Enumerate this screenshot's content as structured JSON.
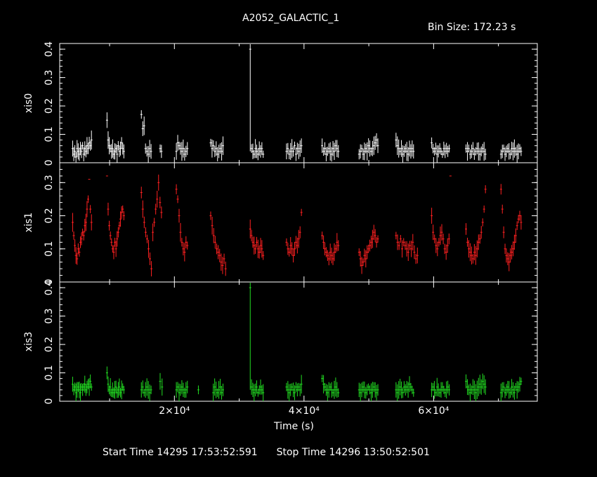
{
  "title": "A2052_GALACTIC_1",
  "bin_size_label": "Bin Size: 172.23 s",
  "footer": {
    "start_label": "Start Time",
    "start_value": "14295 17:53:52:591",
    "stop_label": "Stop Time",
    "stop_value": "14296 13:50:52:501"
  },
  "colors": {
    "background": "#000000",
    "axes": "#ffffff",
    "xis0": "#ffffff",
    "xis1": "#ff2020",
    "xis3": "#22dd22"
  },
  "chart_data": {
    "type": "scatter",
    "xlabel": "Time (s)",
    "xlim": [
      2300,
      76000
    ],
    "x_ticks": [
      20000,
      40000,
      60000
    ],
    "x_tick_labels": [
      "2×10⁴",
      "4×10⁴",
      "6×10⁴"
    ],
    "grid": false,
    "panels": [
      {
        "name": "xis0",
        "ylabel": "xis0",
        "ylim": [
          0,
          0.42
        ],
        "yticks": [
          0,
          0.1,
          0.2,
          0.3,
          0.4
        ],
        "ytick_labels": [
          "0",
          "0.1",
          "0.2",
          "0.3",
          "0.4"
        ],
        "color": "#ffffff",
        "segments": [
          {
            "t0": 4300,
            "t1": 7200,
            "v": [
              0.05,
              0.03,
              0.04,
              0.02,
              0.05,
              0.04,
              0.03,
              0.05,
              0.04,
              0.06,
              0.03,
              0.05,
              0.04,
              0.06,
              0.05,
              0.07,
              0.06,
              0.08
            ]
          },
          {
            "t0": 9600,
            "t1": 12200,
            "v": [
              0.15,
              0.08,
              0.06,
              0.05,
              0.04,
              0.05,
              0.03,
              0.04,
              0.05,
              0.03,
              0.06,
              0.04,
              0.05,
              0.07,
              0.05,
              0.04
            ]
          },
          {
            "t0": 14900,
            "t1": 16400,
            "v": [
              0.17,
              0.12,
              0.13,
              0.05,
              0.04,
              0.03,
              0.05,
              0.04
            ]
          },
          {
            "t0": 17800,
            "t1": 18000,
            "v": [
              0.05,
              0.04
            ]
          },
          {
            "t0": 20300,
            "t1": 22000,
            "v": [
              0.04,
              0.07,
              0.06,
              0.05,
              0.04,
              0.05,
              0.03,
              0.04,
              0.05
            ]
          },
          {
            "t0": 25600,
            "t1": 27500,
            "v": [
              0.07,
              0.05,
              0.06,
              0.04,
              0.05,
              0.03,
              0.04,
              0.05,
              0.04,
              0.06
            ]
          },
          {
            "t0": 31700,
            "t1": 33700,
            "v": [
              0.4,
              0.05,
              0.04,
              0.03,
              0.05,
              0.04,
              0.03,
              0.05,
              0.04,
              0.05,
              0.03
            ]
          },
          {
            "t0": 37300,
            "t1": 39600,
            "v": [
              0.04,
              0.05,
              0.03,
              0.04,
              0.05,
              0.04,
              0.06,
              0.03,
              0.05,
              0.04,
              0.05,
              0.06
            ]
          },
          {
            "t0": 42800,
            "t1": 45300,
            "v": [
              0.06,
              0.04,
              0.05,
              0.03,
              0.04,
              0.05,
              0.04,
              0.03,
              0.05,
              0.04,
              0.06,
              0.05,
              0.04
            ]
          },
          {
            "t0": 48500,
            "t1": 51400,
            "v": [
              0.03,
              0.04,
              0.05,
              0.03,
              0.04,
              0.05,
              0.04,
              0.06,
              0.05,
              0.04,
              0.05,
              0.06,
              0.07,
              0.08,
              0.06
            ]
          },
          {
            "t0": 54200,
            "t1": 56900,
            "v": [
              0.08,
              0.06,
              0.05,
              0.04,
              0.05,
              0.03,
              0.04,
              0.05,
              0.04,
              0.03,
              0.05,
              0.04,
              0.05,
              0.04
            ]
          },
          {
            "t0": 59700,
            "t1": 62400,
            "v": [
              0.07,
              0.05,
              0.04,
              0.05,
              0.03,
              0.04,
              0.05,
              0.04,
              0.03,
              0.05,
              0.04,
              0.05,
              0.04,
              0.05
            ]
          },
          {
            "t0": 65000,
            "t1": 68000,
            "v": [
              0.05,
              0.04,
              0.05,
              0.03,
              0.04,
              0.05,
              0.03,
              0.04,
              0.05,
              0.04,
              0.03,
              0.04,
              0.05,
              0.04,
              0.03
            ]
          },
          {
            "t0": 70400,
            "t1": 73500,
            "v": [
              0.03,
              0.04,
              0.05,
              0.03,
              0.04,
              0.05,
              0.04,
              0.03,
              0.05,
              0.04,
              0.05,
              0.04,
              0.03,
              0.04,
              0.05,
              0.04
            ]
          }
        ]
      },
      {
        "name": "xis1",
        "ylabel": "xis1",
        "ylim": [
          0,
          0.36
        ],
        "yticks": [
          0,
          0.1,
          0.2,
          0.3
        ],
        "ytick_labels": [
          "0",
          "0.1",
          "0.2",
          "0.3"
        ],
        "color": "#ff2020",
        "segments": [
          {
            "t0": 4300,
            "t1": 7200,
            "v": [
              0.18,
              0.14,
              0.11,
              0.08,
              0.07,
              0.1,
              0.09,
              0.12,
              0.13,
              0.15,
              0.14,
              0.17,
              0.18,
              0.22,
              0.25,
              0.31,
              0.22,
              0.18
            ]
          },
          {
            "t0": 9600,
            "t1": 12200,
            "v": [
              0.32,
              0.22,
              0.17,
              0.14,
              0.12,
              0.1,
              0.09,
              0.12,
              0.1,
              0.13,
              0.15,
              0.17,
              0.19,
              0.21,
              0.22,
              0.2
            ]
          },
          {
            "t0": 14900,
            "t1": 18000,
            "v": [
              0.27,
              0.22,
              0.18,
              0.15,
              0.13,
              0.1,
              0.07,
              0.04,
              0.15,
              0.18,
              0.22,
              0.25,
              0.3,
              0.24,
              0.21
            ]
          },
          {
            "t0": 20300,
            "t1": 22000,
            "v": [
              0.28,
              0.25,
              0.2,
              0.15,
              0.12,
              0.1,
              0.09,
              0.12,
              0.11
            ]
          },
          {
            "t0": 25600,
            "t1": 27900,
            "v": [
              0.2,
              0.17,
              0.14,
              0.12,
              0.1,
              0.09,
              0.08,
              0.06,
              0.05,
              0.07,
              0.04
            ]
          },
          {
            "t0": 31700,
            "t1": 33700,
            "v": [
              0.16,
              0.14,
              0.12,
              0.11,
              0.1,
              0.12,
              0.1,
              0.09,
              0.11,
              0.1,
              0.08
            ]
          },
          {
            "t0": 37300,
            "t1": 39600,
            "v": [
              0.12,
              0.1,
              0.09,
              0.11,
              0.1,
              0.08,
              0.1,
              0.12,
              0.11,
              0.13,
              0.15,
              0.21
            ]
          },
          {
            "t0": 42800,
            "t1": 45300,
            "v": [
              0.14,
              0.12,
              0.1,
              0.09,
              0.08,
              0.07,
              0.09,
              0.08,
              0.07,
              0.09,
              0.1,
              0.12,
              0.11
            ]
          },
          {
            "t0": 48500,
            "t1": 51400,
            "v": [
              0.09,
              0.07,
              0.05,
              0.06,
              0.08,
              0.07,
              0.09,
              0.1,
              0.11,
              0.12,
              0.13,
              0.15,
              0.14,
              0.12,
              0.13
            ]
          },
          {
            "t0": 54200,
            "t1": 57500,
            "v": [
              0.14,
              0.12,
              0.11,
              0.13,
              0.1,
              0.12,
              0.11,
              0.1,
              0.09,
              0.11,
              0.1,
              0.12,
              0.09,
              0.07,
              0.08
            ]
          },
          {
            "t0": 59700,
            "t1": 62600,
            "v": [
              0.2,
              0.15,
              0.13,
              0.11,
              0.1,
              0.12,
              0.14,
              0.15,
              0.13,
              0.1,
              0.09,
              0.11,
              0.13,
              0.32
            ]
          },
          {
            "t0": 65000,
            "t1": 68000,
            "v": [
              0.16,
              0.12,
              0.1,
              0.09,
              0.08,
              0.07,
              0.09,
              0.08,
              0.1,
              0.12,
              0.13,
              0.15,
              0.18,
              0.22,
              0.28
            ]
          },
          {
            "t0": 70400,
            "t1": 73500,
            "v": [
              0.28,
              0.22,
              0.15,
              0.1,
              0.08,
              0.07,
              0.06,
              0.08,
              0.09,
              0.1,
              0.12,
              0.14,
              0.17,
              0.19,
              0.2,
              0.18
            ]
          }
        ]
      },
      {
        "name": "xis3",
        "ylabel": "xis3",
        "ylim": [
          0,
          0.42
        ],
        "yticks": [
          0,
          0.1,
          0.2,
          0.3,
          0.4
        ],
        "ytick_labels": [
          "0",
          "0.1",
          "0.2",
          "0.3",
          "0.4"
        ],
        "color": "#22dd22",
        "segments": [
          {
            "t0": 4300,
            "t1": 7200,
            "v": [
              0.06,
              0.04,
              0.05,
              0.03,
              0.04,
              0.05,
              0.04,
              0.03,
              0.05,
              0.04,
              0.05,
              0.06,
              0.04,
              0.05,
              0.06,
              0.05,
              0.07,
              0.05
            ]
          },
          {
            "t0": 9600,
            "t1": 12200,
            "v": [
              0.1,
              0.06,
              0.04,
              0.05,
              0.03,
              0.04,
              0.03,
              0.04,
              0.05,
              0.03,
              0.04,
              0.05,
              0.03,
              0.04,
              0.05,
              0.04
            ]
          },
          {
            "t0": 14900,
            "t1": 16400,
            "v": [
              0.04,
              0.05,
              0.03,
              0.04,
              0.05,
              0.04,
              0.03,
              0.04
            ]
          },
          {
            "t0": 17800,
            "t1": 18100,
            "v": [
              0.07,
              0.05
            ]
          },
          {
            "t0": 20300,
            "t1": 22000,
            "v": [
              0.04,
              0.05,
              0.03,
              0.04,
              0.05,
              0.04,
              0.03,
              0.04,
              0.05
            ]
          },
          {
            "t0": 23700,
            "t1": 23900,
            "v": [
              0.04
            ]
          },
          {
            "t0": 26000,
            "t1": 27500,
            "v": [
              0.03,
              0.05,
              0.04,
              0.03,
              0.04,
              0.05,
              0.03,
              0.04
            ]
          },
          {
            "t0": 31700,
            "t1": 33700,
            "v": [
              0.4,
              0.05,
              0.04,
              0.03,
              0.04,
              0.05,
              0.03,
              0.04,
              0.05,
              0.04,
              0.03
            ]
          },
          {
            "t0": 37300,
            "t1": 39600,
            "v": [
              0.05,
              0.04,
              0.03,
              0.04,
              0.05,
              0.04,
              0.03,
              0.05,
              0.04,
              0.05,
              0.04,
              0.06
            ]
          },
          {
            "t0": 42800,
            "t1": 45300,
            "v": [
              0.08,
              0.06,
              0.05,
              0.04,
              0.03,
              0.04,
              0.05,
              0.04,
              0.03,
              0.04,
              0.05,
              0.04,
              0.03
            ]
          },
          {
            "t0": 48500,
            "t1": 51400,
            "v": [
              0.04,
              0.03,
              0.04,
              0.05,
              0.04,
              0.03,
              0.04,
              0.05,
              0.04,
              0.03,
              0.04,
              0.05,
              0.04,
              0.03,
              0.04
            ]
          },
          {
            "t0": 54200,
            "t1": 56900,
            "v": [
              0.04,
              0.03,
              0.04,
              0.05,
              0.04,
              0.03,
              0.05,
              0.04,
              0.05,
              0.04,
              0.06,
              0.05,
              0.04,
              0.03
            ]
          },
          {
            "t0": 59700,
            "t1": 62400,
            "v": [
              0.04,
              0.05,
              0.04,
              0.03,
              0.05,
              0.04,
              0.03,
              0.04,
              0.05,
              0.04,
              0.03,
              0.04,
              0.05,
              0.04
            ]
          },
          {
            "t0": 65000,
            "t1": 68000,
            "v": [
              0.07,
              0.05,
              0.04,
              0.03,
              0.04,
              0.05,
              0.04,
              0.03,
              0.04,
              0.05,
              0.06,
              0.05,
              0.07,
              0.06,
              0.05
            ]
          },
          {
            "t0": 70400,
            "t1": 73500,
            "v": [
              0.03,
              0.04,
              0.05,
              0.03,
              0.04,
              0.05,
              0.04,
              0.03,
              0.05,
              0.04,
              0.03,
              0.05,
              0.04,
              0.05,
              0.06,
              0.07
            ]
          }
        ]
      }
    ]
  }
}
